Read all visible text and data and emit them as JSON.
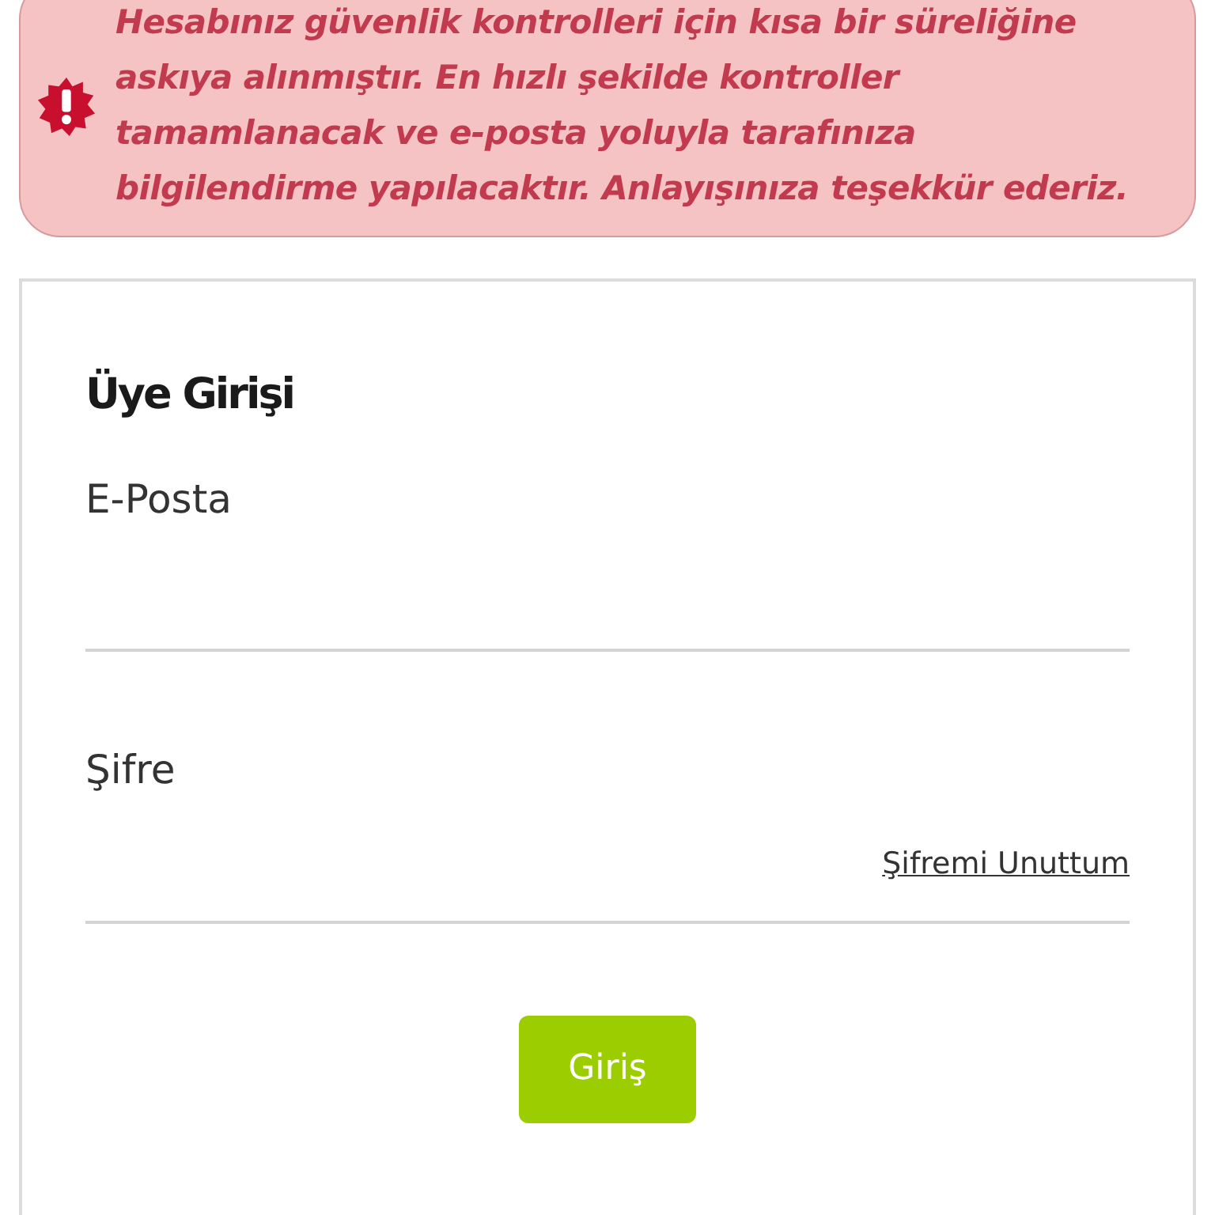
{
  "alert": {
    "message": "Hesabınız güvenlik kontrolleri için kısa bir süreliğine askıya alınmıştır. En hızlı şekilde kontroller tamamlanacak ve e-posta yoluyla tarafınıza bilgilendirme yapılacaktır. Anlayışınıza teşekkür ederiz."
  },
  "login": {
    "title": "Üye Girişi",
    "fields": [
      {
        "label": "E-Posta"
      },
      {
        "label": "Şifre",
        "link": "Şifremi Unuttum"
      }
    ],
    "submit": "Giriş"
  }
}
